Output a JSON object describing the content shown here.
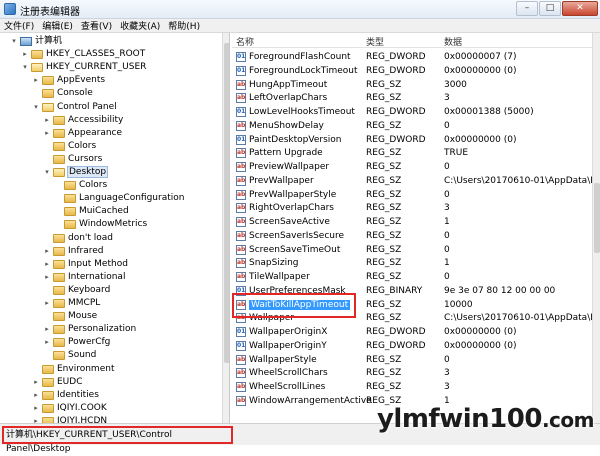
{
  "window": {
    "title": "注册表编辑器"
  },
  "menu": [
    "文件(F)",
    "编辑(E)",
    "查看(V)",
    "收藏夹(A)",
    "帮助(H)"
  ],
  "tree": [
    {
      "label": "计算机",
      "level": 0,
      "toggle": "▾",
      "icon": "pc"
    },
    {
      "label": "HKEY_CLASSES_ROOT",
      "level": 1,
      "toggle": "▸"
    },
    {
      "label": "HKEY_CURRENT_USER",
      "level": 1,
      "toggle": "▾",
      "open": true
    },
    {
      "label": "AppEvents",
      "level": 2,
      "toggle": "▸"
    },
    {
      "label": "Console",
      "level": 2,
      "toggle": ""
    },
    {
      "label": "Control Panel",
      "level": 2,
      "toggle": "▾",
      "open": true
    },
    {
      "label": "Accessibility",
      "level": 3,
      "toggle": "▸"
    },
    {
      "label": "Appearance",
      "level": 3,
      "toggle": "▸"
    },
    {
      "label": "Colors",
      "level": 3,
      "toggle": ""
    },
    {
      "label": "Cursors",
      "level": 3,
      "toggle": ""
    },
    {
      "label": "Desktop",
      "level": 3,
      "toggle": "▾",
      "open": true,
      "selected": true
    },
    {
      "label": "Colors",
      "level": 4,
      "toggle": ""
    },
    {
      "label": "LanguageConfiguration",
      "level": 4,
      "toggle": ""
    },
    {
      "label": "MuiCached",
      "level": 4,
      "toggle": ""
    },
    {
      "label": "WindowMetrics",
      "level": 4,
      "toggle": ""
    },
    {
      "label": "don't load",
      "level": 3,
      "toggle": ""
    },
    {
      "label": "Infrared",
      "level": 3,
      "toggle": "▸"
    },
    {
      "label": "Input Method",
      "level": 3,
      "toggle": "▸"
    },
    {
      "label": "International",
      "level": 3,
      "toggle": "▸"
    },
    {
      "label": "Keyboard",
      "level": 3,
      "toggle": ""
    },
    {
      "label": "MMCPL",
      "level": 3,
      "toggle": "▸"
    },
    {
      "label": "Mouse",
      "level": 3,
      "toggle": ""
    },
    {
      "label": "Personalization",
      "level": 3,
      "toggle": "▸"
    },
    {
      "label": "PowerCfg",
      "level": 3,
      "toggle": "▸"
    },
    {
      "label": "Sound",
      "level": 3,
      "toggle": ""
    },
    {
      "label": "Environment",
      "level": 2,
      "toggle": ""
    },
    {
      "label": "EUDC",
      "level": 2,
      "toggle": "▸"
    },
    {
      "label": "Identities",
      "level": 2,
      "toggle": "▸"
    },
    {
      "label": "IQIYI.COOK",
      "level": 2,
      "toggle": "▸"
    },
    {
      "label": "IQIYI.HCDN",
      "level": 2,
      "toggle": "▸"
    }
  ],
  "list": {
    "headers": {
      "name": "名称",
      "type": "类型",
      "data": "数据"
    },
    "rows": [
      {
        "name": "ForegroundFlashCount",
        "type": "REG_DWORD",
        "data": "0x00000007 (7)",
        "icon": "dw"
      },
      {
        "name": "ForegroundLockTimeout",
        "type": "REG_DWORD",
        "data": "0x00000000 (0)",
        "icon": "dw"
      },
      {
        "name": "HungAppTimeout",
        "type": "REG_SZ",
        "data": "3000",
        "icon": "sz"
      },
      {
        "name": "LeftOverlapChars",
        "type": "REG_SZ",
        "data": "3",
        "icon": "sz"
      },
      {
        "name": "LowLevelHooksTimeout",
        "type": "REG_DWORD",
        "data": "0x00001388 (5000)",
        "icon": "dw"
      },
      {
        "name": "MenuShowDelay",
        "type": "REG_SZ",
        "data": "0",
        "icon": "sz"
      },
      {
        "name": "PaintDesktopVersion",
        "type": "REG_DWORD",
        "data": "0x00000000 (0)",
        "icon": "dw"
      },
      {
        "name": "Pattern Upgrade",
        "type": "REG_SZ",
        "data": "TRUE",
        "icon": "sz"
      },
      {
        "name": "PreviewWallpaper",
        "type": "REG_SZ",
        "data": "0",
        "icon": "sz"
      },
      {
        "name": "PrevWallpaper",
        "type": "REG_SZ",
        "data": "C:\\Users\\20170610-01\\AppData\\Ro",
        "icon": "sz"
      },
      {
        "name": "PrevWallpaperStyle",
        "type": "REG_SZ",
        "data": "0",
        "icon": "sz"
      },
      {
        "name": "RightOverlapChars",
        "type": "REG_SZ",
        "data": "3",
        "icon": "sz"
      },
      {
        "name": "ScreenSaveActive",
        "type": "REG_SZ",
        "data": "1",
        "icon": "sz"
      },
      {
        "name": "ScreenSaverIsSecure",
        "type": "REG_SZ",
        "data": "0",
        "icon": "sz"
      },
      {
        "name": "ScreenSaveTimeOut",
        "type": "REG_SZ",
        "data": "0",
        "icon": "sz"
      },
      {
        "name": "SnapSizing",
        "type": "REG_SZ",
        "data": "1",
        "icon": "sz"
      },
      {
        "name": "TileWallpaper",
        "type": "REG_SZ",
        "data": "0",
        "icon": "sz"
      },
      {
        "name": "UserPreferencesMask",
        "type": "REG_BINARY",
        "data": "9e 3e 07 80 12 00 00 00",
        "icon": "dw"
      },
      {
        "name": "WaitToKillAppTimeout",
        "type": "REG_SZ",
        "data": "10000",
        "icon": "sz",
        "selected": true
      },
      {
        "name": "Wallpaper",
        "type": "REG_SZ",
        "data": "C:\\Users\\20170610-01\\AppData\\Ro",
        "icon": "sz"
      },
      {
        "name": "WallpaperOriginX",
        "type": "REG_DWORD",
        "data": "0x00000000 (0)",
        "icon": "dw"
      },
      {
        "name": "WallpaperOriginY",
        "type": "REG_DWORD",
        "data": "0x00000000 (0)",
        "icon": "dw"
      },
      {
        "name": "WallpaperStyle",
        "type": "REG_SZ",
        "data": "0",
        "icon": "sz"
      },
      {
        "name": "WheelScrollChars",
        "type": "REG_SZ",
        "data": "3",
        "icon": "sz"
      },
      {
        "name": "WheelScrollLines",
        "type": "REG_SZ",
        "data": "3",
        "icon": "sz"
      },
      {
        "name": "WindowArrangementActive",
        "type": "REG_SZ",
        "data": "1",
        "icon": "sz"
      }
    ]
  },
  "status": {
    "path": "计算机\\HKEY_CURRENT_USER\\Control Panel\\Desktop"
  },
  "watermark": {
    "main": "ylmfwin100",
    "suffix": ".com"
  }
}
